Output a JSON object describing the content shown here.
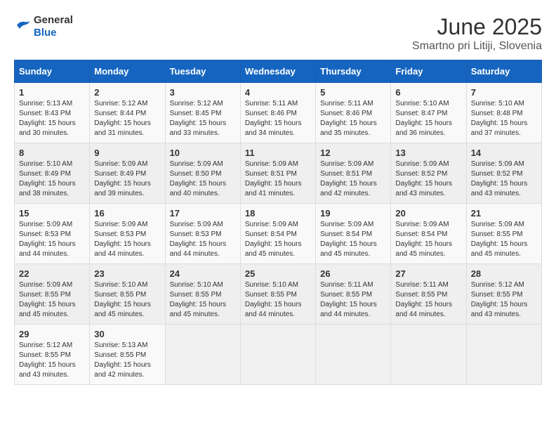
{
  "header": {
    "logo_general": "General",
    "logo_blue": "Blue",
    "title": "June 2025",
    "subtitle": "Smartno pri Litiji, Slovenia"
  },
  "calendar": {
    "headers": [
      "Sunday",
      "Monday",
      "Tuesday",
      "Wednesday",
      "Thursday",
      "Friday",
      "Saturday"
    ],
    "weeks": [
      [
        null,
        null,
        null,
        null,
        {
          "day": "1",
          "sunrise": "Sunrise: 5:13 AM",
          "sunset": "Sunset: 8:43 PM",
          "daylight": "Daylight: 15 hours and 30 minutes."
        },
        {
          "day": "2",
          "sunrise": "Sunrise: 5:12 AM",
          "sunset": "Sunset: 8:44 PM",
          "daylight": "Daylight: 15 hours and 31 minutes."
        },
        {
          "day": "3",
          "sunrise": "Sunrise: 5:12 AM",
          "sunset": "Sunset: 8:45 PM",
          "daylight": "Daylight: 15 hours and 33 minutes."
        },
        {
          "day": "4",
          "sunrise": "Sunrise: 5:11 AM",
          "sunset": "Sunset: 8:46 PM",
          "daylight": "Daylight: 15 hours and 34 minutes."
        },
        {
          "day": "5",
          "sunrise": "Sunrise: 5:11 AM",
          "sunset": "Sunset: 8:46 PM",
          "daylight": "Daylight: 15 hours and 35 minutes."
        },
        {
          "day": "6",
          "sunrise": "Sunrise: 5:10 AM",
          "sunset": "Sunset: 8:47 PM",
          "daylight": "Daylight: 15 hours and 36 minutes."
        },
        {
          "day": "7",
          "sunrise": "Sunrise: 5:10 AM",
          "sunset": "Sunset: 8:48 PM",
          "daylight": "Daylight: 15 hours and 37 minutes."
        }
      ],
      [
        {
          "day": "8",
          "sunrise": "Sunrise: 5:10 AM",
          "sunset": "Sunset: 8:49 PM",
          "daylight": "Daylight: 15 hours and 38 minutes."
        },
        {
          "day": "9",
          "sunrise": "Sunrise: 5:09 AM",
          "sunset": "Sunset: 8:49 PM",
          "daylight": "Daylight: 15 hours and 39 minutes."
        },
        {
          "day": "10",
          "sunrise": "Sunrise: 5:09 AM",
          "sunset": "Sunset: 8:50 PM",
          "daylight": "Daylight: 15 hours and 40 minutes."
        },
        {
          "day": "11",
          "sunrise": "Sunrise: 5:09 AM",
          "sunset": "Sunset: 8:51 PM",
          "daylight": "Daylight: 15 hours and 41 minutes."
        },
        {
          "day": "12",
          "sunrise": "Sunrise: 5:09 AM",
          "sunset": "Sunset: 8:51 PM",
          "daylight": "Daylight: 15 hours and 42 minutes."
        },
        {
          "day": "13",
          "sunrise": "Sunrise: 5:09 AM",
          "sunset": "Sunset: 8:52 PM",
          "daylight": "Daylight: 15 hours and 43 minutes."
        },
        {
          "day": "14",
          "sunrise": "Sunrise: 5:09 AM",
          "sunset": "Sunset: 8:52 PM",
          "daylight": "Daylight: 15 hours and 43 minutes."
        }
      ],
      [
        {
          "day": "15",
          "sunrise": "Sunrise: 5:09 AM",
          "sunset": "Sunset: 8:53 PM",
          "daylight": "Daylight: 15 hours and 44 minutes."
        },
        {
          "day": "16",
          "sunrise": "Sunrise: 5:09 AM",
          "sunset": "Sunset: 8:53 PM",
          "daylight": "Daylight: 15 hours and 44 minutes."
        },
        {
          "day": "17",
          "sunrise": "Sunrise: 5:09 AM",
          "sunset": "Sunset: 8:53 PM",
          "daylight": "Daylight: 15 hours and 44 minutes."
        },
        {
          "day": "18",
          "sunrise": "Sunrise: 5:09 AM",
          "sunset": "Sunset: 8:54 PM",
          "daylight": "Daylight: 15 hours and 45 minutes."
        },
        {
          "day": "19",
          "sunrise": "Sunrise: 5:09 AM",
          "sunset": "Sunset: 8:54 PM",
          "daylight": "Daylight: 15 hours and 45 minutes."
        },
        {
          "day": "20",
          "sunrise": "Sunrise: 5:09 AM",
          "sunset": "Sunset: 8:54 PM",
          "daylight": "Daylight: 15 hours and 45 minutes."
        },
        {
          "day": "21",
          "sunrise": "Sunrise: 5:09 AM",
          "sunset": "Sunset: 8:55 PM",
          "daylight": "Daylight: 15 hours and 45 minutes."
        }
      ],
      [
        {
          "day": "22",
          "sunrise": "Sunrise: 5:09 AM",
          "sunset": "Sunset: 8:55 PM",
          "daylight": "Daylight: 15 hours and 45 minutes."
        },
        {
          "day": "23",
          "sunrise": "Sunrise: 5:10 AM",
          "sunset": "Sunset: 8:55 PM",
          "daylight": "Daylight: 15 hours and 45 minutes."
        },
        {
          "day": "24",
          "sunrise": "Sunrise: 5:10 AM",
          "sunset": "Sunset: 8:55 PM",
          "daylight": "Daylight: 15 hours and 45 minutes."
        },
        {
          "day": "25",
          "sunrise": "Sunrise: 5:10 AM",
          "sunset": "Sunset: 8:55 PM",
          "daylight": "Daylight: 15 hours and 44 minutes."
        },
        {
          "day": "26",
          "sunrise": "Sunrise: 5:11 AM",
          "sunset": "Sunset: 8:55 PM",
          "daylight": "Daylight: 15 hours and 44 minutes."
        },
        {
          "day": "27",
          "sunrise": "Sunrise: 5:11 AM",
          "sunset": "Sunset: 8:55 PM",
          "daylight": "Daylight: 15 hours and 44 minutes."
        },
        {
          "day": "28",
          "sunrise": "Sunrise: 5:12 AM",
          "sunset": "Sunset: 8:55 PM",
          "daylight": "Daylight: 15 hours and 43 minutes."
        }
      ],
      [
        {
          "day": "29",
          "sunrise": "Sunrise: 5:12 AM",
          "sunset": "Sunset: 8:55 PM",
          "daylight": "Daylight: 15 hours and 43 minutes."
        },
        {
          "day": "30",
          "sunrise": "Sunrise: 5:13 AM",
          "sunset": "Sunset: 8:55 PM",
          "daylight": "Daylight: 15 hours and 42 minutes."
        },
        null,
        null,
        null,
        null,
        null
      ]
    ]
  }
}
